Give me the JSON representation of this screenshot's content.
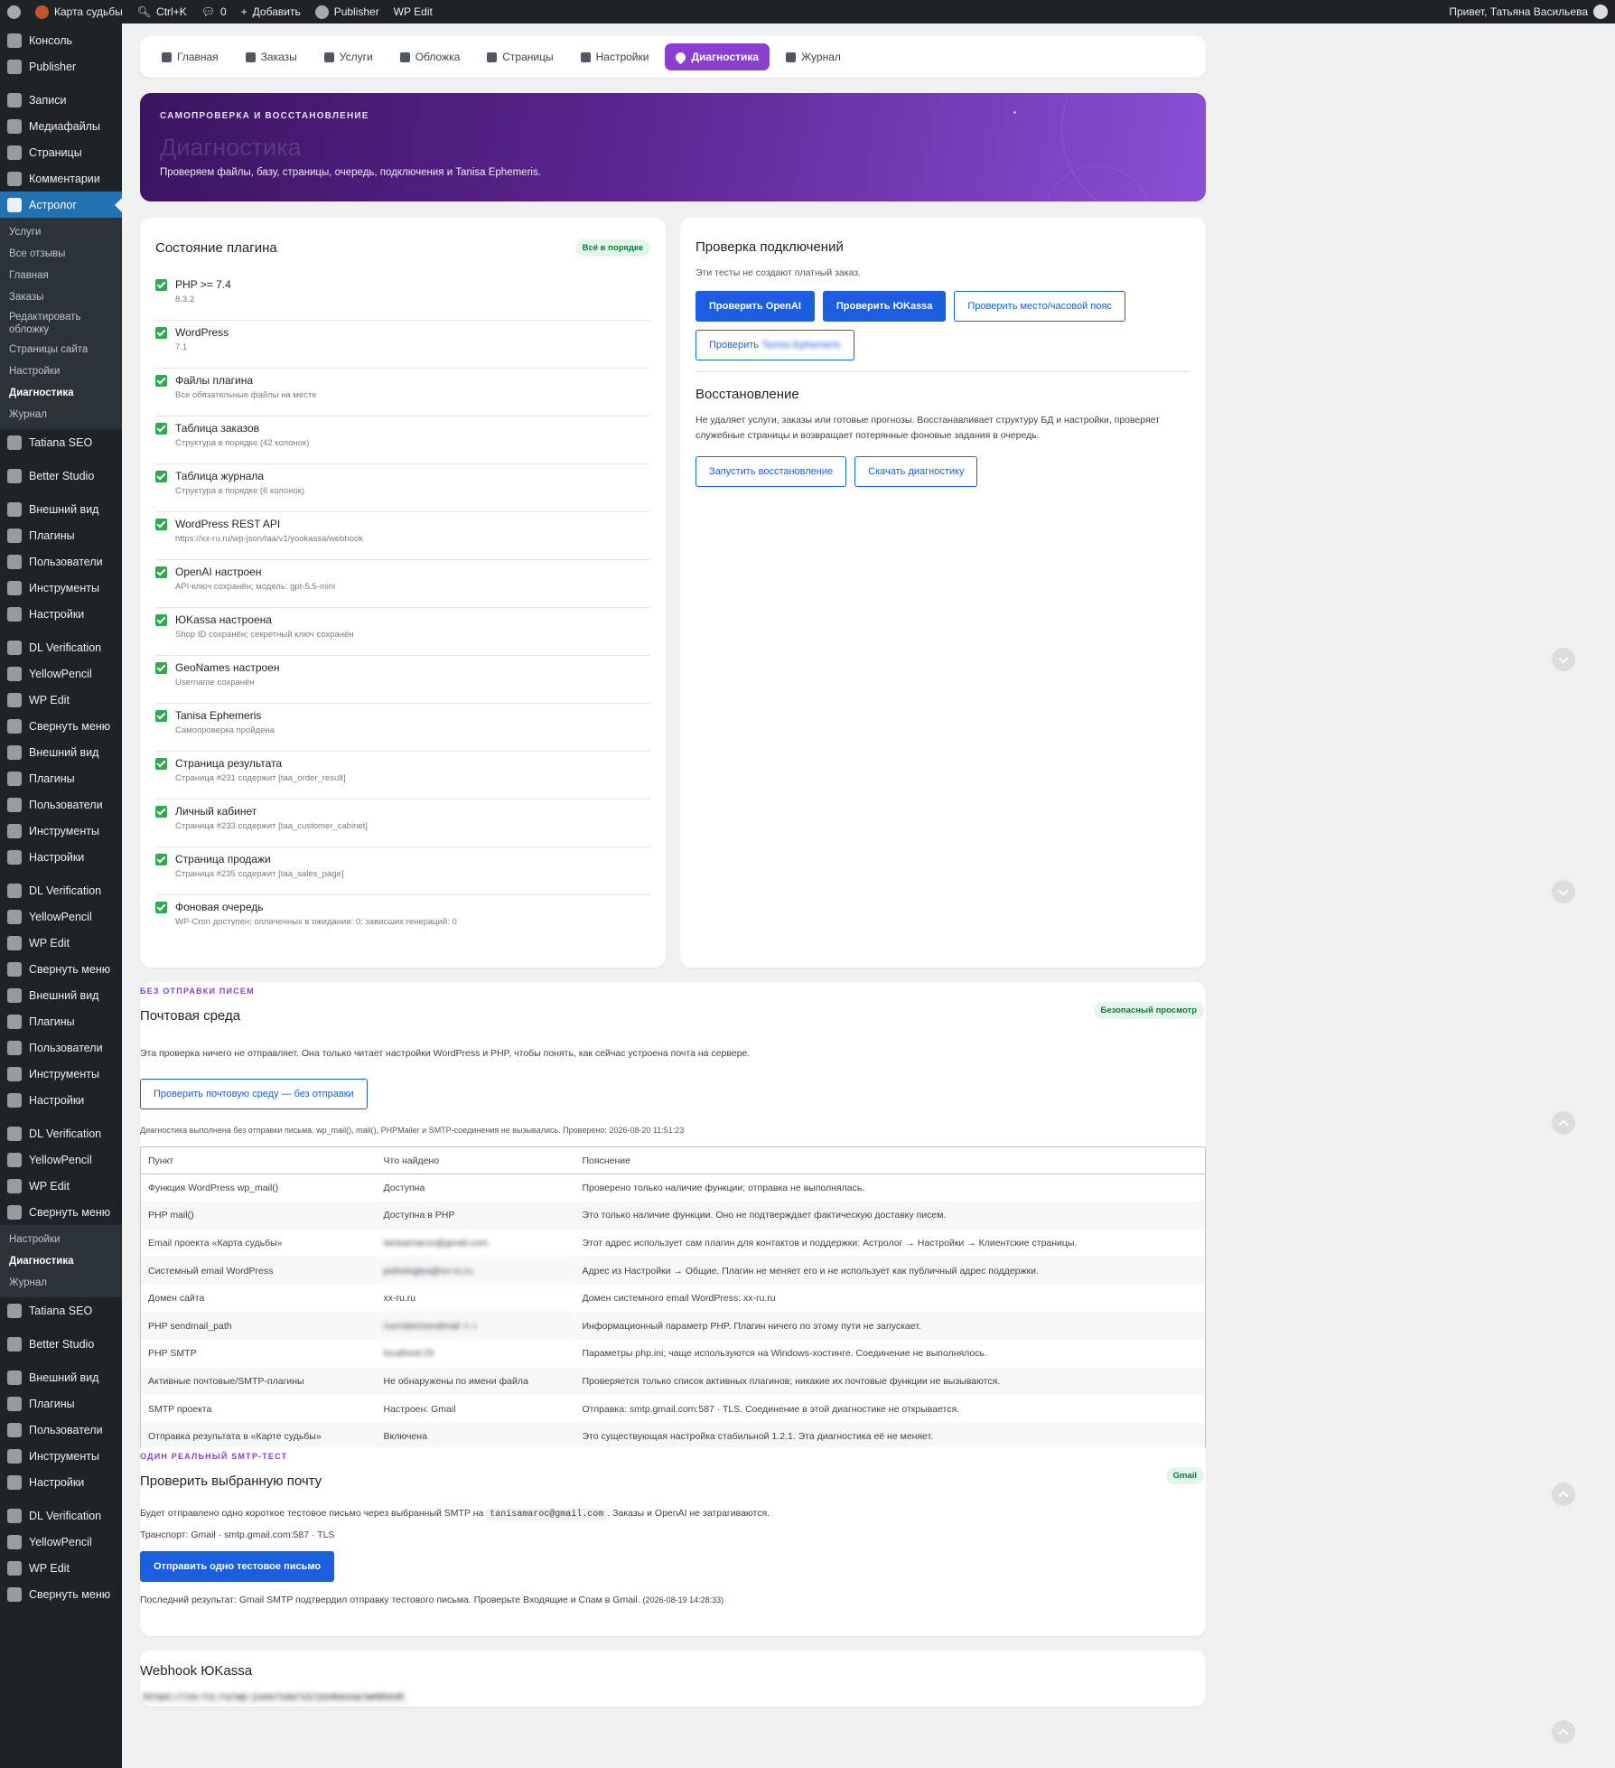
{
  "adminbar": {
    "site": "Карта судьбы",
    "search": "Ctrl+K",
    "comments": "0",
    "add": "Добавить",
    "publisher": "Publisher",
    "wpedit": "WP Edit",
    "greeting": "Привет, Татьяна Васильева"
  },
  "sidebar": {
    "top": [
      "Консоль",
      "Publisher"
    ],
    "main": [
      "Записи",
      "Медиафайлы",
      "Страницы",
      "Комментарии"
    ],
    "active": "Астролог",
    "submenu": [
      "Услуги",
      "Все отзывы",
      "Главная",
      "Заказы",
      "Редактировать обложку",
      "Страницы сайта",
      "Настройки"
    ],
    "submenu_current": "Диагностика",
    "submenu_last": "Журнал",
    "plugins1": [
      "Tatiana SEO",
      "Better Studio"
    ],
    "group": [
      "Внешний вид",
      "Плагины",
      "Пользователи",
      "Инструменты",
      "Настройки"
    ],
    "group2": [
      "DL Verification",
      "YellowPencil",
      "WP Edit",
      "Свернуть меню"
    ]
  },
  "nav": {
    "tabs": [
      "Главная",
      "Заказы",
      "Услуги",
      "Обложка",
      "Страницы",
      "Настройки",
      "Диагностика",
      "Журнал"
    ]
  },
  "hero": {
    "kicker": "Самопроверка и восстановление",
    "title": "Диагностика",
    "subtitle": "Проверяем файлы, базу, страницы, очередь, подключения и Tanisa Ephemeris."
  },
  "status": {
    "title": "Состояние плагина",
    "badge": "Всё в порядке",
    "items": [
      {
        "title": "PHP >= 7.4",
        "sub": "8.3.2"
      },
      {
        "title": "WordPress",
        "sub": "7.1"
      },
      {
        "title": "Файлы плагина",
        "sub": "Все обязательные файлы на месте"
      },
      {
        "title": "Таблица заказов",
        "sub": "Структура в порядке (42 колонок)"
      },
      {
        "title": "Таблица журнала",
        "sub": "Структура в порядке (6 колонок)"
      },
      {
        "title": "WordPress REST API",
        "sub": "https://xx-ru.ru/wp-json/taa/v1/yookassa/webhook"
      },
      {
        "title": "OpenAI настроен",
        "sub": "API-ключ сохранён; модель: gpt-5.5-mini"
      },
      {
        "title": "ЮKassa настроена",
        "sub": "Shop ID сохранён; секретный ключ сохранён"
      },
      {
        "title": "GeoNames настроен",
        "sub": "Username сохранён"
      },
      {
        "title": "Tanisa Ephemeris",
        "sub": "Самопроверка пройдена"
      },
      {
        "title": "Страница результата",
        "sub": "Страница #231 содержит [taa_order_result]"
      },
      {
        "title": "Личный кабинет",
        "sub": "Страница #233 содержит [taa_customer_cabinet]"
      },
      {
        "title": "Страница продажи",
        "sub": "Страница #235 содержит [taa_sales_page]"
      },
      {
        "title": "Фоновая очередь",
        "sub": "WP-Cron доступен; оплаченных в ожидании: 0; зависших генераций: 0"
      }
    ]
  },
  "connections": {
    "title": "Проверка подключений",
    "note": "Эти тесты не создают платный заказ.",
    "btn_openai": "Проверить OpenAI",
    "btn_yookassa": "Проверить ЮKassa",
    "btn_geo": "Проверить место/часовой пояс",
    "btn_eph": "Проверить Tanisa Ephemeris",
    "restore_title": "Восстановление",
    "restore_text": "Не удаляет услуги, заказы или готовые прогнозы. Восстанавливает структуру БД и настройки, проверяет служебные страницы и возвращает потерянные фоновые задания в очередь.",
    "btn_restore": "Запустить восстановление",
    "btn_download": "Скачать диагностику"
  },
  "mail": {
    "kicker": "Без отправки писем",
    "title": "Почтовая среда",
    "badge": "Безопасный просмотр",
    "text": "Эта проверка ничего не отправляет. Она только читает настройки WordPress и PHP, чтобы понять, как сейчас устроена почта на сервере.",
    "button": "Проверить почтовую среду — без отправки",
    "note": "Диагностика выполнена без отправки письма. wp_mail(), mail(), PHPMailer и SMTP-соединения не вызывались. Проверено: 2026-08-20 11:51:23",
    "headers": [
      "Пункт",
      "Что найдено",
      "Пояснение"
    ],
    "rows": [
      {
        "item": "Функция WordPress wp_mail()",
        "found": "Доступна",
        "note": "Проверено только наличие функции; отправка не выполнялась."
      },
      {
        "item": "PHP mail()",
        "found": "Доступна в PHP",
        "note": "Это только наличие функции. Оно не подтверждает фактическую доставку писем."
      },
      {
        "item": "Email проекта «Карта судьбы»",
        "found": "tanisamaroc@gmail.com",
        "note": "Этот адрес использует сам плагин для контактов и поддержки: Астролог → Настройки → Клиентские страницы."
      },
      {
        "item": "Системный email WordPress",
        "found": "psihologlya@xx-ru.ru",
        "note": "Адрес из Настройки → Общие. Плагин не меняет его и не использует как публичный адрес поддержки."
      },
      {
        "item": "Домен сайта",
        "found": "xx-ru.ru",
        "note": "Домен системного email WordPress: xx-ru.ru"
      },
      {
        "item": "PHP sendmail_path",
        "found": "/usr/sbin/sendmail -t -i",
        "note": "Информационный параметр PHP. Плагин ничего по этому пути не запускает."
      },
      {
        "item": "PHP SMTP",
        "found": "localhost:25",
        "note": "Параметры php.ini; чаще используются на Windows-хостинге. Соединение не выполнялось."
      },
      {
        "item": "Активные почтовые/SMTP-плагины",
        "found": "Не обнаружены по имени файла",
        "note": "Проверяется только список активных плагинов; никакие их почтовые функции не вызываются."
      },
      {
        "item": "SMTP проекта",
        "found": "Настроен: Gmail",
        "note": "Отправка: smtp.gmail.com:587 · TLS. Соединение в этой диагностике не открывается."
      },
      {
        "item": "Отправка результата в «Карте судьбы»",
        "found": "Включена",
        "note": "Это существующая настройка стабильной 1.2.1. Эта диагностика её не меняет."
      }
    ]
  },
  "smtp": {
    "kicker": "Один реальный SMTP-тест",
    "title": "Проверить выбранную почту",
    "badge": "Gmail",
    "text_before": "Будет отправлено одно короткое тестовое письмо через выбранный SMTP на",
    "email": "tanisamaroc@gmail.com",
    "text_after": ". Заказы и OpenAI не затрагиваются.",
    "transport": "Транспорт: Gmail · smtp.gmail.com:587 · TLS",
    "button": "Отправить одно тестовое письмо",
    "result": "Последний результат: Gmail SMTP подтвердил отправку тестового письма. Проверьте Входящие и Спам в Gmail.",
    "result_time": "(2026-08-19 14:28:33)"
  },
  "webhook": {
    "title": "Webhook ЮKassa",
    "url": "https://xx-ru.ru/wp-json/taa/v1/yookassa/webhook"
  },
  "colors": {
    "accent": "#8b3fd1",
    "primary": "#1b5fe0",
    "success": "#2fa84f",
    "admin_bg": "#1d2327"
  }
}
